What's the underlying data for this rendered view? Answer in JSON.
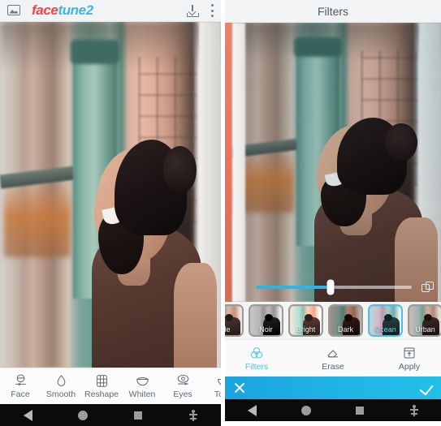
{
  "left_screen": {
    "appbar": {
      "gallery_icon": "gallery-icon",
      "logo_part1": "face",
      "logo_part2": "tune2",
      "download_icon": "download-icon",
      "overflow_icon": "overflow-menu-icon"
    },
    "photo_alt": "Smiling bearded man with hair bun on a city street",
    "toolbar": [
      {
        "label": "Face",
        "icon": "face-icon"
      },
      {
        "label": "Smooth",
        "icon": "droplet-icon"
      },
      {
        "label": "Reshape",
        "icon": "grid-icon"
      },
      {
        "label": "Whiten",
        "icon": "teeth-icon"
      },
      {
        "label": "Eyes",
        "icon": "eye-icon"
      },
      {
        "label": "Touc",
        "icon": "touchup-icon"
      }
    ]
  },
  "right_screen": {
    "title": "Filters",
    "slider": {
      "value_percent": 48,
      "compare_icon": "compare-icon"
    },
    "filters": [
      {
        "label": "de",
        "style": "fade",
        "selected": false
      },
      {
        "label": "Noir",
        "style": "noir",
        "selected": false
      },
      {
        "label": "Bright",
        "style": "bright",
        "selected": false
      },
      {
        "label": "Dark",
        "style": "dark",
        "selected": false
      },
      {
        "label": "Ocean",
        "style": "selected",
        "selected": true
      },
      {
        "label": "Urban",
        "style": "urban",
        "selected": false
      }
    ],
    "tabs": [
      {
        "label": "Filters",
        "icon": "filters-icon",
        "active": true
      },
      {
        "label": "Erase",
        "icon": "eraser-icon",
        "active": false
      },
      {
        "label": "Apply",
        "icon": "apply-icon",
        "active": false
      }
    ],
    "action_bar": {
      "cancel_icon": "close-icon",
      "confirm_icon": "check-icon",
      "accent_color": "#21b4e6"
    }
  },
  "navbar": {
    "back_icon": "back-triangle-icon",
    "home_icon": "home-circle-icon",
    "recents_icon": "recents-square-icon",
    "accessibility_icon": "accessibility-icon"
  },
  "colors": {
    "accent_blue": "#29b6e8",
    "logo_red": "#f5424b",
    "logo_blue": "#3ab6e8",
    "toolbar_text": "#5b6b78"
  }
}
